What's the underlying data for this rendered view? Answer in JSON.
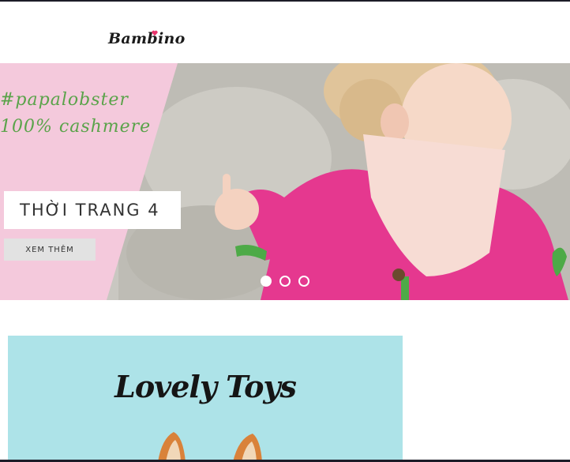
{
  "header": {
    "logo_text": "Bambino",
    "logo_heart_color": "#e8336b"
  },
  "hero": {
    "hashtag_line1": "#papalobster",
    "hashtag_line2": "100% cashmere",
    "slide_title": "THỜI TRANG 4",
    "cta_label": "XEM THÊM",
    "slide_count": 3,
    "active_slide": 1,
    "accent_pink": "#f4c9dc",
    "hashtag_color": "#5aa34a"
  },
  "promo": {
    "title": "Lovely Toys",
    "background": "#ade3e8"
  }
}
